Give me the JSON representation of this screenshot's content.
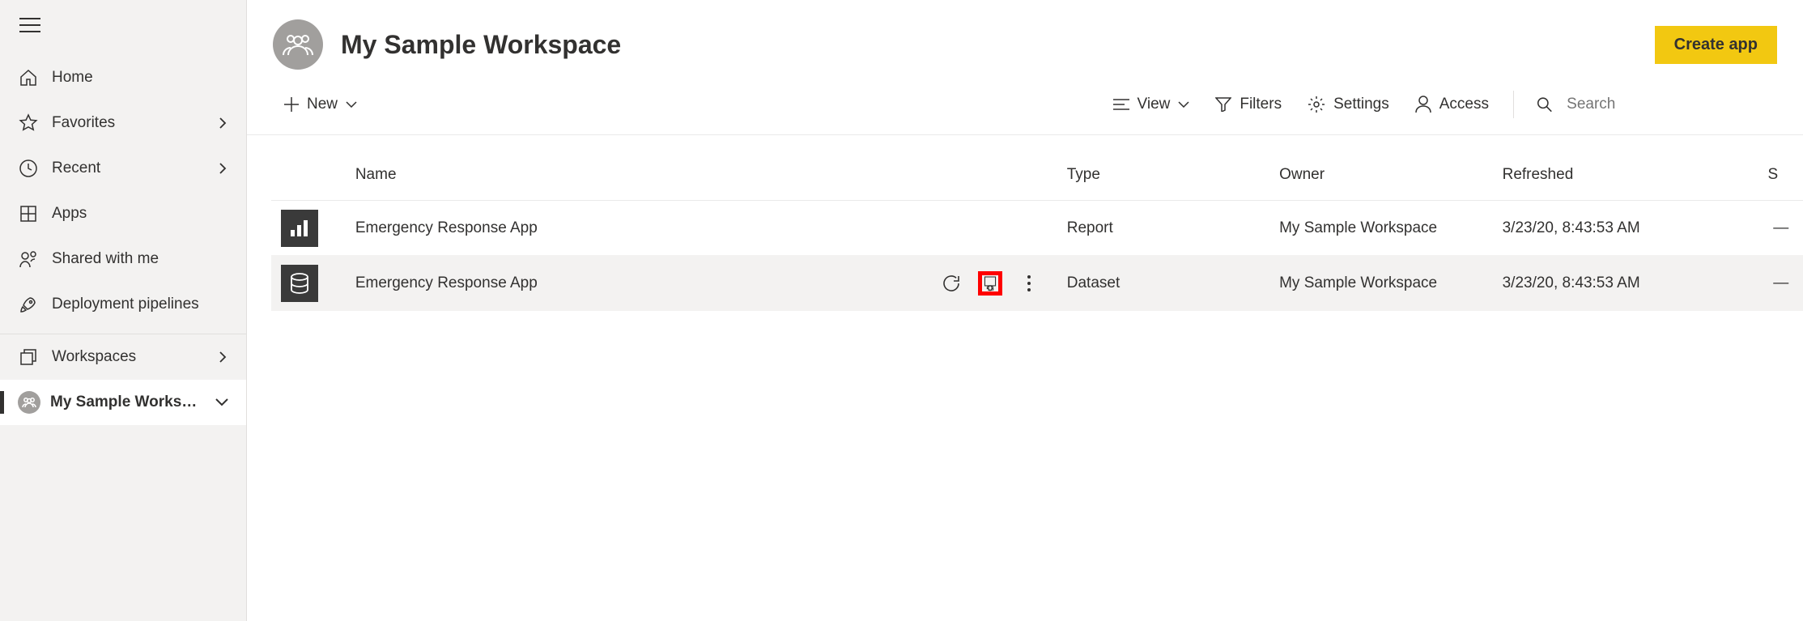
{
  "sidebar": {
    "items": [
      {
        "label": "Home"
      },
      {
        "label": "Favorites"
      },
      {
        "label": "Recent"
      },
      {
        "label": "Apps"
      },
      {
        "label": "Shared with me"
      },
      {
        "label": "Deployment pipelines"
      }
    ],
    "workspaces_label": "Workspaces",
    "current_workspace": "My Sample Works…"
  },
  "header": {
    "title": "My Sample Workspace",
    "create_app_label": "Create app"
  },
  "toolbar": {
    "new_label": "New",
    "view_label": "View",
    "filters_label": "Filters",
    "settings_label": "Settings",
    "access_label": "Access",
    "search_placeholder": "Search"
  },
  "table": {
    "columns": {
      "name": "Name",
      "type": "Type",
      "owner": "Owner",
      "refreshed": "Refreshed",
      "last_cut": "S"
    },
    "rows": [
      {
        "name": "Emergency Response App",
        "type": "Report",
        "owner": "My Sample Workspace",
        "refreshed": "3/23/20, 8:43:53 AM",
        "dash": "—"
      },
      {
        "name": "Emergency Response App",
        "type": "Dataset",
        "owner": "My Sample Workspace",
        "refreshed": "3/23/20, 8:43:53 AM",
        "dash": "—"
      }
    ]
  }
}
